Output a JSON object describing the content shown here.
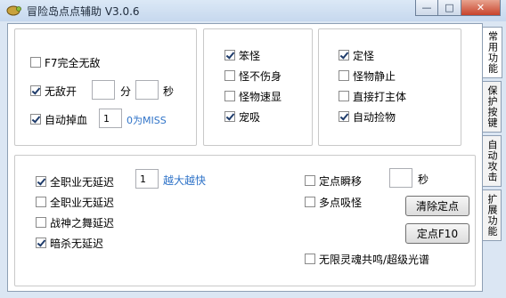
{
  "window": {
    "title": "冒险岛点点辅助 V3.0.6",
    "min_symbol": "—",
    "max_symbol": "□",
    "close_symbol": "✕"
  },
  "tabs": [
    {
      "label": "常用功能",
      "active": true
    },
    {
      "label": "保护按键",
      "active": false
    },
    {
      "label": "自动攻击",
      "active": false
    },
    {
      "label": "扩展功能",
      "active": false
    }
  ],
  "group1": {
    "f7": {
      "label": "F7完全无敌",
      "checked": false
    },
    "invincible": {
      "label": "无敌开",
      "checked": true,
      "min_value": "",
      "min_unit": "分",
      "sec_value": "",
      "sec_unit": "秒"
    },
    "auto_drop": {
      "label": "自动掉血",
      "checked": true,
      "value": "1",
      "hint": "0为MISS"
    }
  },
  "group2": {
    "items": [
      {
        "label": "笨怪",
        "checked": true
      },
      {
        "label": "怪不伤身",
        "checked": false
      },
      {
        "label": "怪物速显",
        "checked": false
      },
      {
        "label": "宠吸",
        "checked": true
      }
    ]
  },
  "group3": {
    "items": [
      {
        "label": "定怪",
        "checked": true
      },
      {
        "label": "怪物静止",
        "checked": false
      },
      {
        "label": "直接打主体",
        "checked": false
      },
      {
        "label": "自动捡物",
        "checked": true
      }
    ]
  },
  "group4": {
    "items": [
      {
        "label": "全职业无延迟",
        "checked": true
      },
      {
        "label": "全职业无延迟",
        "checked": false
      },
      {
        "label": "战神之舞延迟",
        "checked": false
      },
      {
        "label": "暗杀无延迟",
        "checked": true
      }
    ],
    "speed_value": "1",
    "speed_hint": "越大越快",
    "teleport": {
      "label": "定点瞬移",
      "checked": false,
      "value": "",
      "unit": "秒"
    },
    "multi_suck": {
      "label": "多点吸怪",
      "checked": false
    },
    "clear_button": "清除定点",
    "set_button": "定点F10",
    "soul": {
      "label": "无限灵魂共鸣/超级光谱",
      "checked": false
    }
  },
  "colors": {
    "hint_blue": "#2f73c8"
  }
}
